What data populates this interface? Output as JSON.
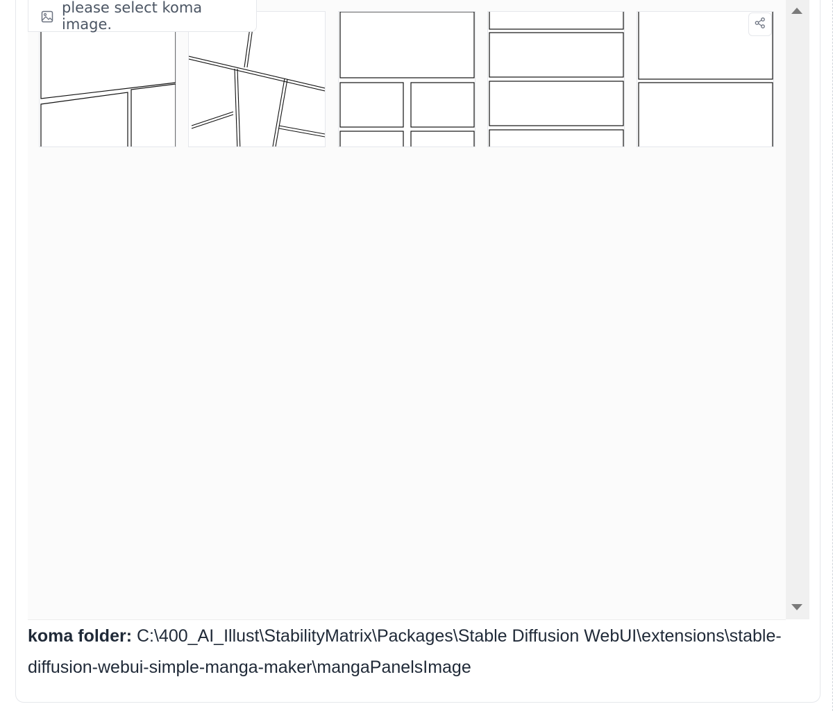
{
  "gallery": {
    "label": "please select koma image.",
    "label_icon": "image-icon",
    "share_icon": "share-icon",
    "thumbnails": [
      {
        "name": "koma-layout-1"
      },
      {
        "name": "koma-layout-2"
      },
      {
        "name": "koma-layout-3"
      },
      {
        "name": "koma-layout-4"
      },
      {
        "name": "koma-layout-5"
      }
    ]
  },
  "koma_folder": {
    "label": "koma folder:",
    "path": "C:\\400_AI_Illust\\StabilityMatrix\\Packages\\Stable Diffusion WebUI\\extensions\\stable-diffusion-webui-simple-manga-maker\\mangaPanelsImage"
  },
  "colors": {
    "border": "#e5e7eb",
    "scrollbar": "#f0f0f0",
    "text": "#1f2937"
  }
}
